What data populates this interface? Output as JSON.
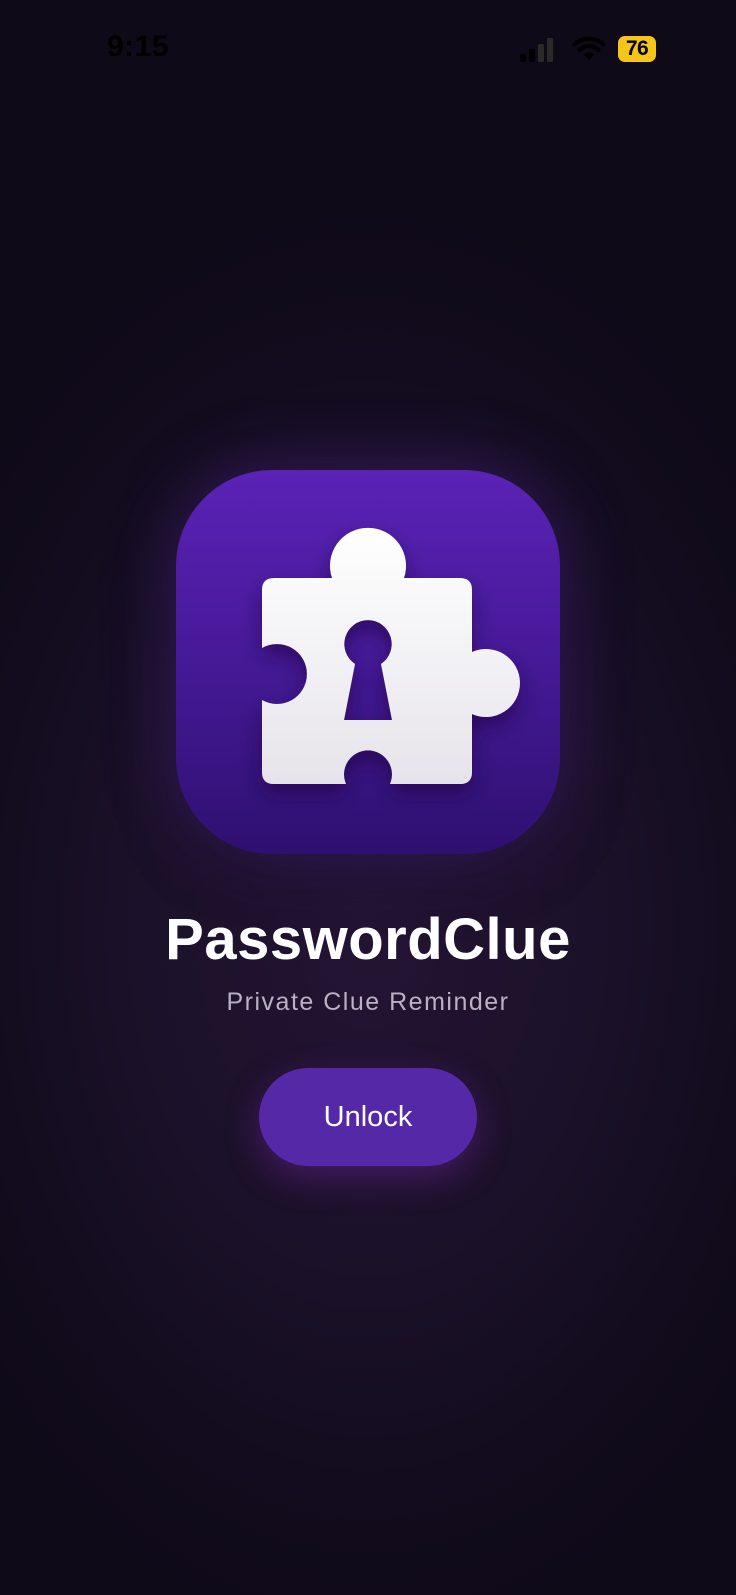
{
  "status_bar": {
    "time": "9:15",
    "battery_level": "76",
    "signal_icon": "cellular-signal-icon",
    "wifi_icon": "wifi-icon",
    "battery_color": "#f5c518"
  },
  "app": {
    "icon": "puzzle-piece-keyhole-icon",
    "name": "PasswordClue",
    "tagline": "Private Clue Reminder"
  },
  "actions": {
    "unlock_label": "Unlock"
  },
  "colors": {
    "accent": "#5528a8",
    "icon_background": "#4a1c9e"
  }
}
